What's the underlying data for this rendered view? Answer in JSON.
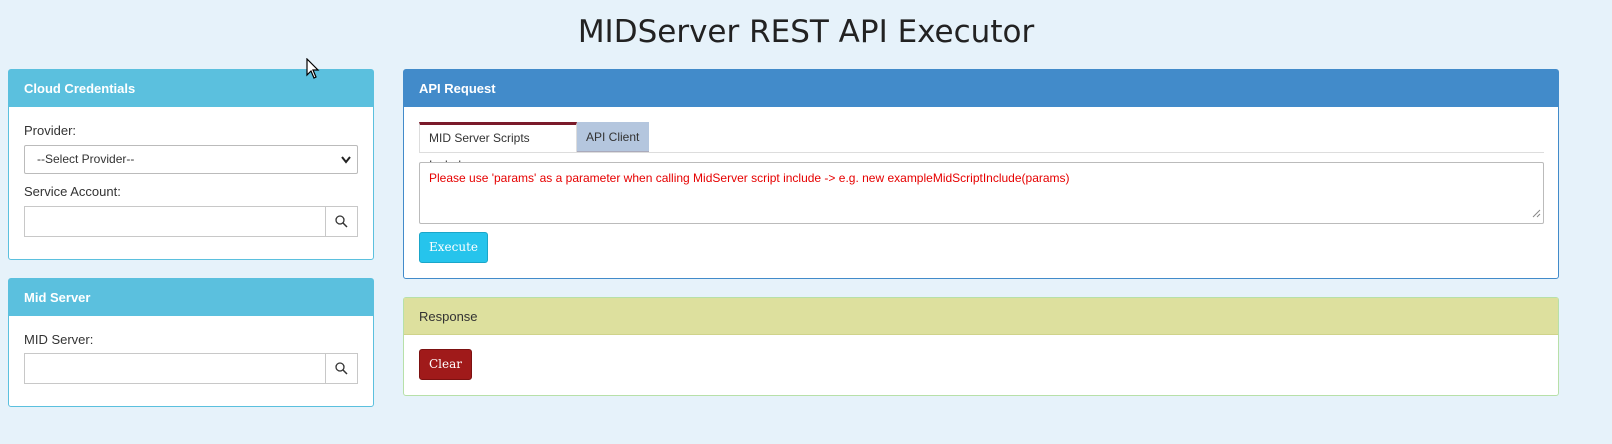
{
  "page": {
    "title": "MIDServer REST API Executor"
  },
  "cloud_credentials": {
    "heading": "Cloud Credentials",
    "provider_label": "Provider:",
    "provider_selected": "--Select Provider--",
    "service_account_label": "Service Account:",
    "service_account_value": ""
  },
  "mid_server": {
    "heading": "Mid Server",
    "mid_server_label": "MID Server:",
    "mid_server_value": ""
  },
  "api_request": {
    "heading": "API Request",
    "tabs": [
      {
        "label": "MID Server Scripts Include",
        "active": true
      },
      {
        "label": "API Client",
        "active": false
      }
    ],
    "script_text": "Please use 'params' as a parameter when calling MidServer script include -> e.g. new exampleMidScriptInclude(params)",
    "execute_label": "Execute"
  },
  "response": {
    "heading": "Response",
    "clear_label": "Clear"
  },
  "colors": {
    "info": "#5bc0de",
    "primary": "#428bca",
    "success_heading": "#dde09e",
    "execute": "#26c4ec",
    "clear": "#a01a1a",
    "hint_text": "#e60000"
  }
}
